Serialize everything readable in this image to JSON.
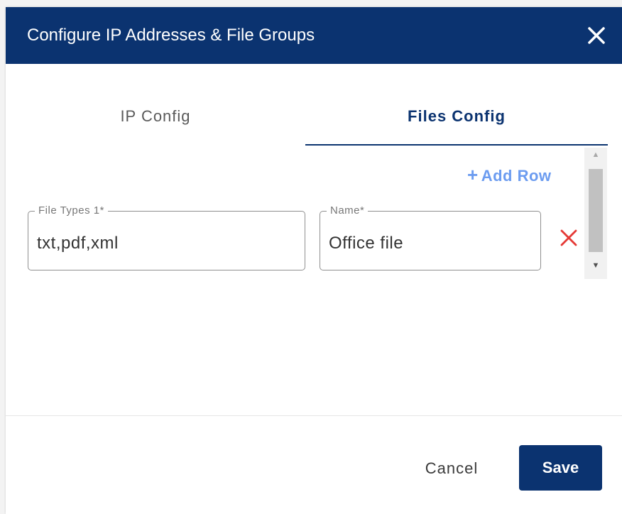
{
  "dialog": {
    "title": "Configure IP Addresses & File Groups",
    "close_icon": "close-icon"
  },
  "tabs": [
    {
      "label": "IP Config",
      "active": false
    },
    {
      "label": "Files Config",
      "active": true
    }
  ],
  "files_config": {
    "add_row_icon": "plus-icon",
    "add_row_label": "Add Row",
    "rows": [
      {
        "file_types": {
          "label": "File Types 1*",
          "value": "txt,pdf,xml"
        },
        "name": {
          "label": "Name*",
          "value": "Office file"
        },
        "delete_icon": "delete-x-icon"
      }
    ]
  },
  "footer": {
    "cancel_label": "Cancel",
    "save_label": "Save"
  },
  "colors": {
    "header_bg": "#0b3370",
    "accent": "#0b3370",
    "add_row": "#6c9cf0",
    "delete": "#e53935"
  }
}
